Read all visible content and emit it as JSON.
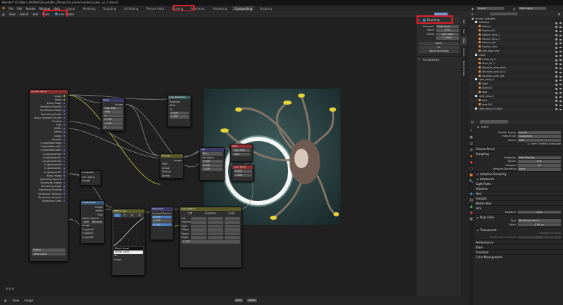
{
  "title": "Blender* [D:\\Work_WORKS\\Zbrush\\My_ZProjects\\Lurkers\\render\\Lurker_nn_5.blend]",
  "menu": [
    "File",
    "Edit",
    "Render",
    "Window",
    "Help"
  ],
  "workspaces": [
    "Layout",
    "Modeling",
    "Sculpting",
    "UV Editing",
    "Texture Paint",
    "Shading",
    "Animation",
    "Rendering",
    "Compositing",
    "Scripting"
  ],
  "active_workspace": "Compositing",
  "top_right": {
    "scene": "Scene",
    "view_layer": "View Layer"
  },
  "node_header": {
    "menus": [
      "View",
      "Select",
      "Add",
      "Node"
    ],
    "use_nodes": "Use Nodes",
    "backdrop": "Backdrop"
  },
  "sidebar": {
    "backdrop_label": "Backdrop",
    "channels_label": "Channels",
    "channels_value": "Color and...",
    "zoom_label": "Zoom",
    "zoom_value": "0.51",
    "offset_label": "Offset",
    "offset_x": "-265.2000",
    "offset_y": "2.3000",
    "move": "Move",
    "fit": "Fit",
    "reset": "Reset Backdrop",
    "annotations": "Annotations",
    "tabs": [
      "Item",
      "Tool",
      "View",
      "Options",
      "Node Wrangler"
    ]
  },
  "outliner": {
    "header": "Scene Collection",
    "items": [
      {
        "name": "Collection",
        "indent": 1
      },
      {
        "name": "Camera",
        "indent": 2
      },
      {
        "name": "Camera.001",
        "indent": 2
      },
      {
        "name": "Camera_focus_1",
        "indent": 2
      },
      {
        "name": "Camera_focus_2",
        "indent": 2
      },
      {
        "name": "Camera_left",
        "indent": 2
      },
      {
        "name": "Camera_main",
        "indent": 2
      },
      {
        "name": "Cam_base_mat",
        "indent": 2
      },
      {
        "name": "Lurker",
        "indent": 1
      },
      {
        "name": "Lurker_rm_5",
        "indent": 2
      },
      {
        "name": "Teeth_LH_1",
        "indent": 2
      },
      {
        "name": "Tentacles_inner_thick",
        "indent": 2
      },
      {
        "name": "Tentacles_inner_LH_1",
        "indent": 2
      },
      {
        "name": "Tentacles_outer_adt",
        "indent": 2
      },
      {
        "name": "Light_setup_1",
        "indent": 1
      },
      {
        "name": "Light",
        "indent": 2
      },
      {
        "name": "Light.001",
        "indent": 2
      },
      {
        "name": "Spot",
        "indent": 2
      },
      {
        "name": "Light_setup_2",
        "indent": 1
      },
      {
        "name": "Area",
        "indent": 2
      },
      {
        "name": "Area.001",
        "indent": 2
      },
      {
        "name": "Light_setup_3_FLASH",
        "indent": 1
      }
    ]
  },
  "properties": {
    "header": "Scene",
    "render_engine_label": "Render Engine",
    "render_engine": "Cycles",
    "feature_set_label": "Feature Set",
    "feature_set": "Supported",
    "device_label": "Device",
    "device": "CPU",
    "open_shading": "Open Shading Language",
    "sections": {
      "grease": "Grease Pencil",
      "sampling": "Sampling",
      "adaptive": "Adaptive Sampling",
      "advanced": "Advanced",
      "light_paths": "Light Paths",
      "volumes": "Volumes",
      "blur": "Motion Blur",
      "hair": "Hair",
      "simplify": "Simplify",
      "film": "Film",
      "pixel": "Pixel Filter",
      "transparent": "Transparent",
      "perf": "Performance",
      "bake": "Bake",
      "freestyle": "Freestyle",
      "color": "Color Management"
    },
    "integrator_label": "Integrator",
    "integrator": "Path Tracing",
    "render_label": "Render",
    "render_val": "128",
    "viewport_label": "Viewport",
    "viewport_val": "32",
    "denoise_label": "Viewport Denoising",
    "denoise_val": "None",
    "exposure_label": "Exposure",
    "exposure_val": "1.00",
    "type_label": "Type",
    "type_val": "Blackman-Harris",
    "width_label": "Width",
    "width_val": "1.50 px",
    "transparent_glass": "Transparent Glass",
    "roughness_label": "Roughness Threshold",
    "roughness_val": "0.10"
  },
  "nodes": {
    "render_layers": {
      "title": "Render Layers",
      "outputs": [
        "Image",
        "Alpha",
        "Noisy Image",
        "Denoising Normal",
        "Denoising Albedo",
        "Denoising Depth",
        "Noisy Shadow Catcher",
        "Shadow",
        "Emit",
        "DiffDir",
        "DiffInd",
        "Glossy",
        "GlossDir",
        "CryptoMaterial00",
        "CryptoMaterial01",
        "CryptoMaterial02",
        "CryptoObject00",
        "CryptoObject01",
        "CryptoObject02",
        "CryptoAsset00",
        "CryptoAsset01",
        "CryptoAsset02",
        "Noisy Image",
        "Denoising Normal",
        "Denoising Albedo",
        "Denoising Depth",
        "Denoising Shadow",
        "Denoising Variance",
        "Denoising Intensity",
        "Denoising Clean"
      ],
      "scene": "Scene",
      "layer": "View Layer"
    },
    "glare": {
      "title": "Glare",
      "type": "Fog Glow",
      "quality": "High",
      "iter": "3",
      "mix": "0.000",
      "threshold": "1.000",
      "size": "9"
    },
    "denoise": {
      "title": "Denoise",
      "label": "Denoise",
      "hdr": "HDR",
      "inputs": [
        "Image",
        "Normal",
        "Albedo"
      ]
    },
    "composite": {
      "title": "Composite",
      "use_alpha": "Use Alpha",
      "inputs": [
        "Image",
        "Alpha",
        "Z"
      ]
    },
    "lens": {
      "title": "Lens Distortion",
      "projector": "Projector",
      "jitter": "Jitter",
      "fit": "Fit",
      "distort_label": "Distort",
      "distort": "0.000",
      "disp_label": "Dispersion",
      "disp": "0.000"
    },
    "crypto": {
      "title": "Cryptomatte",
      "label": "Matte Objects",
      "add": "Add",
      "remove": "Remove",
      "outputs": [
        "Image",
        "Matte",
        "Pick"
      ],
      "inputs": [
        "Image",
        "Crypto00",
        "Crypto01",
        "Crypto02"
      ]
    },
    "curves": {
      "title": "RGB Curves",
      "tabs": [
        "C",
        "R",
        "G",
        "B"
      ],
      "black": "Black Level",
      "white": "White Level",
      "inputs": [
        "Fac",
        "Image"
      ]
    },
    "alpha_over": {
      "title": "Alpha Over",
      "convert": "Convert Premul",
      "premul": "Premul",
      "premul_val": "0.000",
      "fac": "1.000"
    },
    "color_balance": {
      "title": "Color Balance",
      "offsets": [
        "Lift",
        "Gamma",
        "Gain"
      ],
      "rows": [
        "Lift",
        "Gamma",
        "Gain",
        "Offset",
        "Power",
        "Slope"
      ],
      "fac": "1.000"
    },
    "mix": {
      "title": "Mix",
      "blend": "Mix",
      "use_alpha": "Use Alpha",
      "fac": "0.500"
    },
    "viewer": {
      "title": "Viewer"
    },
    "small_red_1": {
      "title": "Glare"
    },
    "small_red_2": {
      "title": "Color Ramp"
    }
  },
  "bottom": {
    "status": "Scene",
    "left": [
      "View",
      "Image"
    ],
    "center": [
      "View",
      "Zoom"
    ]
  }
}
